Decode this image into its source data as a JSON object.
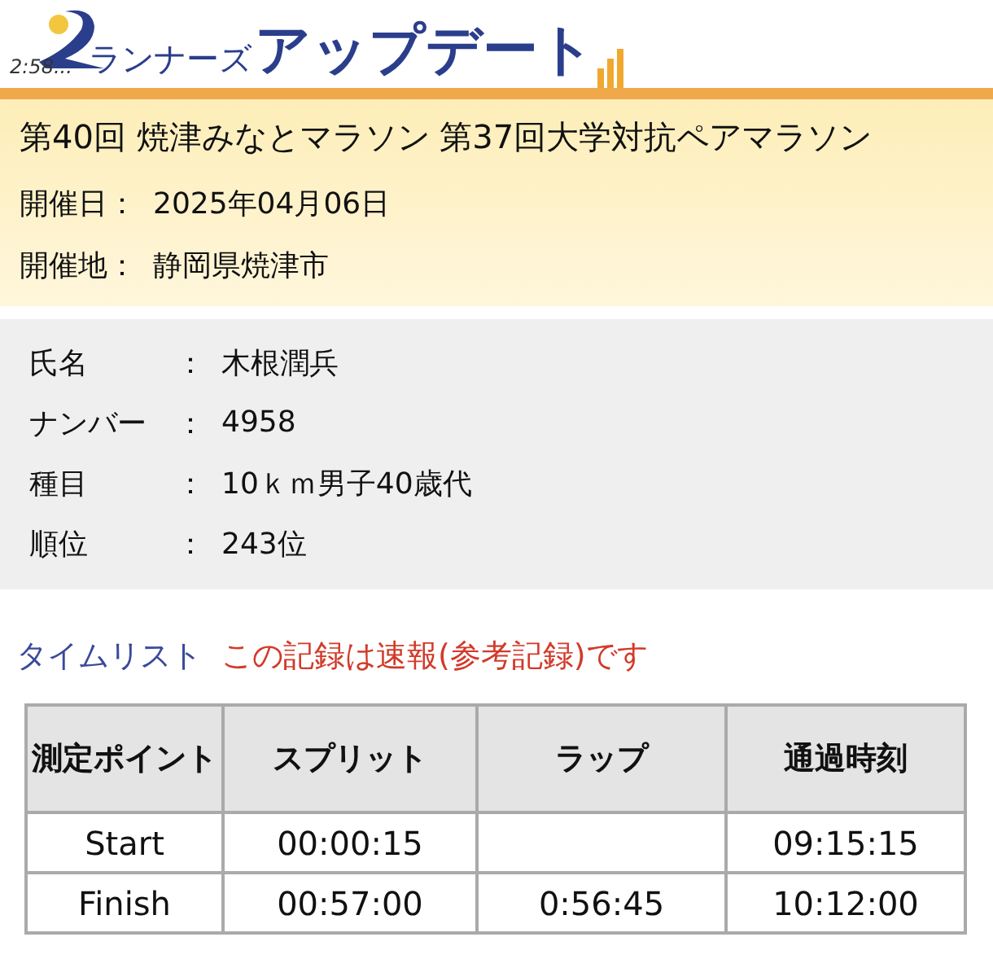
{
  "logo": {
    "clock": "2:58...",
    "brand_small": "ランナーズ",
    "brand_large": "アップデート"
  },
  "event": {
    "title": "第40回 焼津みなとマラソン 第37回大学対抗ペアマラソン",
    "fields": [
      {
        "label": "開催日：",
        "value": "2025年04月06日"
      },
      {
        "label": "開催地：",
        "value": "静岡県焼津市"
      }
    ]
  },
  "runner": [
    {
      "label": "氏名",
      "separator": "：",
      "value": "木根潤兵"
    },
    {
      "label": "ナンバー",
      "separator": "：",
      "value": "4958"
    },
    {
      "label": "種目",
      "separator": "：",
      "value": "10ｋｍ男子40歳代"
    },
    {
      "label": "順位",
      "separator": "：",
      "value": "243位"
    }
  ],
  "time_list": {
    "heading": "タイムリスト",
    "notice": "この記録は速報(参考記録)です",
    "columns": [
      "測定ポイント",
      "スプリット",
      "ラップ",
      "通過時刻"
    ],
    "rows": [
      [
        "Start",
        "00:00:15",
        "",
        "09:15:15"
      ],
      [
        "Finish",
        "00:57:00",
        "0:56:45",
        "10:12:00"
      ]
    ]
  }
}
